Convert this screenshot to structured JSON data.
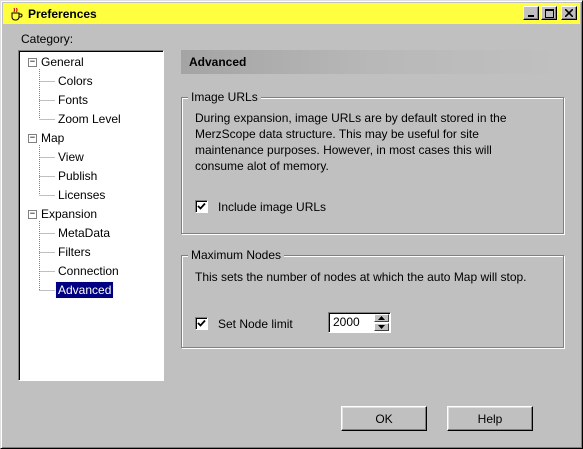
{
  "window": {
    "title": "Preferences",
    "title_icon": "java-cup-icon",
    "controls": [
      "minimize",
      "maximize",
      "close"
    ],
    "titlebar_color": "#ffff40"
  },
  "sidebar": {
    "label": "Category:",
    "tree": [
      {
        "label": "General",
        "expanded": true,
        "children": [
          "Colors",
          "Fonts",
          "Zoom Level"
        ]
      },
      {
        "label": "Map",
        "expanded": true,
        "children": [
          "View",
          "Publish",
          "Licenses"
        ]
      },
      {
        "label": "Expansion",
        "expanded": true,
        "children": [
          "MetaData",
          "Filters",
          "Connection",
          "Advanced"
        ]
      }
    ],
    "selected": "Advanced"
  },
  "main": {
    "header": "Advanced",
    "image_urls": {
      "title": "Image URLs",
      "lines": [
        "During expansion, image URLs are by default stored in the",
        "MerzScope data structure.  This may be useful for site",
        "maintenance purposes. However, in most cases this will",
        "consume alot of memory."
      ],
      "checkbox_label": "Include image URLs",
      "checked": true
    },
    "max_nodes": {
      "title": "Maximum Nodes",
      "description": "This sets the number of nodes at which the auto Map will stop.",
      "checkbox_label": "Set Node limit",
      "checked": true,
      "value": "2000"
    }
  },
  "buttons": {
    "ok": "OK",
    "help": "Help"
  },
  "colors": {
    "selection": "#000080",
    "face": "#c0c0c0"
  }
}
